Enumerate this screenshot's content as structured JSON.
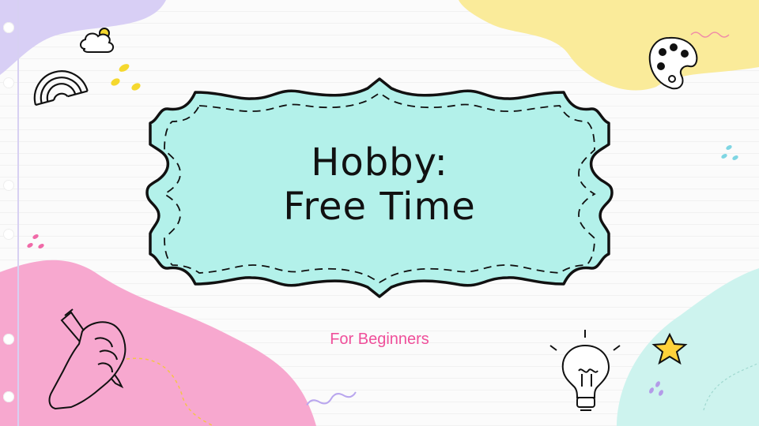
{
  "slide": {
    "title_line1": "Hobby:",
    "title_line2": "Free Time",
    "subtitle": "For Beginners"
  },
  "colors": {
    "frame_fill": "#b3f1ea",
    "frame_stroke": "#111111",
    "subtitle": "#ef4f9a",
    "blob_purple": "#d8cff5",
    "blob_yellow": "#faeb9a",
    "blob_pink": "#f7a8cf",
    "blob_mint": "#cdf3ee",
    "star": "#ffd23a"
  },
  "icons": [
    "cloud-sun-icon",
    "rainbow-icon",
    "paint-palette-icon",
    "light-bulb-icon",
    "star-icon",
    "hand-with-pencil-icon"
  ]
}
